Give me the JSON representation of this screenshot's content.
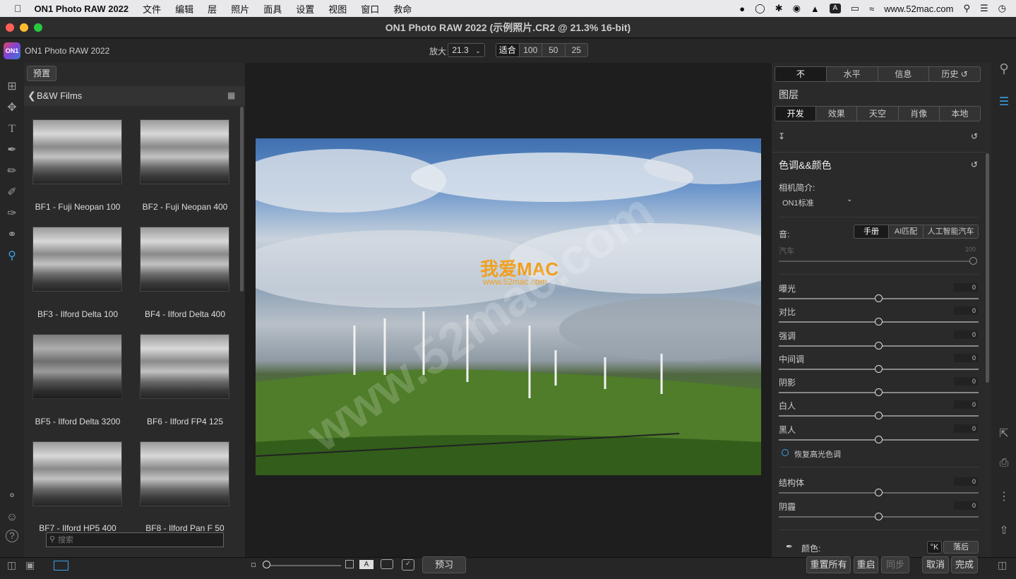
{
  "menubar": {
    "app_name": "ON1 Photo RAW 2022",
    "menus": [
      "文件",
      "编辑",
      "层",
      "照片",
      "面具",
      "设置",
      "视图",
      "窗口",
      "救命"
    ],
    "website": "www.52mac.com"
  },
  "window": {
    "title": "ON1 Photo RAW 2022 (示例照片.CR2 @ 21.3% 16-bit)"
  },
  "toolbar": {
    "app_label": "ON1 Photo RAW 2022",
    "zoom_label": "放大",
    "zoom_value": "21.3",
    "zoom_fit": "适合",
    "zoom_presets": [
      "100",
      "50",
      "25"
    ]
  },
  "left_panel": {
    "presets_button": "预置",
    "category_title": "B&W Films",
    "presets": [
      {
        "name": "BF1 - Fuji Neopan 100"
      },
      {
        "name": "BF2 - Fuji Neopan 400"
      },
      {
        "name": "BF3 - Ilford Delta 100"
      },
      {
        "name": "BF4 - Ilford Delta 400"
      },
      {
        "name": "BF5 - Ilford Delta 3200"
      },
      {
        "name": "BF6 - Ilford FP4 125"
      },
      {
        "name": "BF7 - Ilford HP5 400"
      },
      {
        "name": "BF8 - Ilford Pan F 50"
      }
    ],
    "search_placeholder": "搜索"
  },
  "canvas": {
    "watermark_title": "我爱MAC",
    "watermark_url": "www.52mac.com",
    "watermark_diagonal": "www.52mac.com"
  },
  "right_panel": {
    "top_tabs": [
      "不",
      "水平",
      "信息",
      "历史"
    ],
    "layers_title": "图层",
    "module_tabs": [
      "开发",
      "效果",
      "天空",
      "肖像",
      "本地"
    ],
    "section_title": "色调&&颜色",
    "camera_profile_label": "相机简介:",
    "camera_profile_value": "ON1标准",
    "tone_label": "音:",
    "tone_modes": [
      "手册",
      "AI匹配",
      "人工智能汽车"
    ],
    "auto_label": "汽车",
    "auto_value": "100",
    "sliders": [
      {
        "label": "曝光",
        "value": "0"
      },
      {
        "label": "对比",
        "value": "0"
      },
      {
        "label": "强调",
        "value": "0"
      },
      {
        "label": "中间调",
        "value": "0"
      },
      {
        "label": "阴影",
        "value": "0"
      },
      {
        "label": "白人",
        "value": "0"
      },
      {
        "label": "黑人",
        "value": "0"
      }
    ],
    "recover_highlights": "恢复高光色调",
    "sliders2": [
      {
        "label": "结构体",
        "value": "0"
      },
      {
        "label": "阴霾",
        "value": "0"
      }
    ],
    "color_label": "颜色:",
    "color_k": "°K",
    "color_drop": "落后"
  },
  "bottom_bar": {
    "preview_button": "预习",
    "reset_all": "重置所有",
    "reset": "重启",
    "sync": "同步",
    "cancel": "取消",
    "done": "完成"
  }
}
